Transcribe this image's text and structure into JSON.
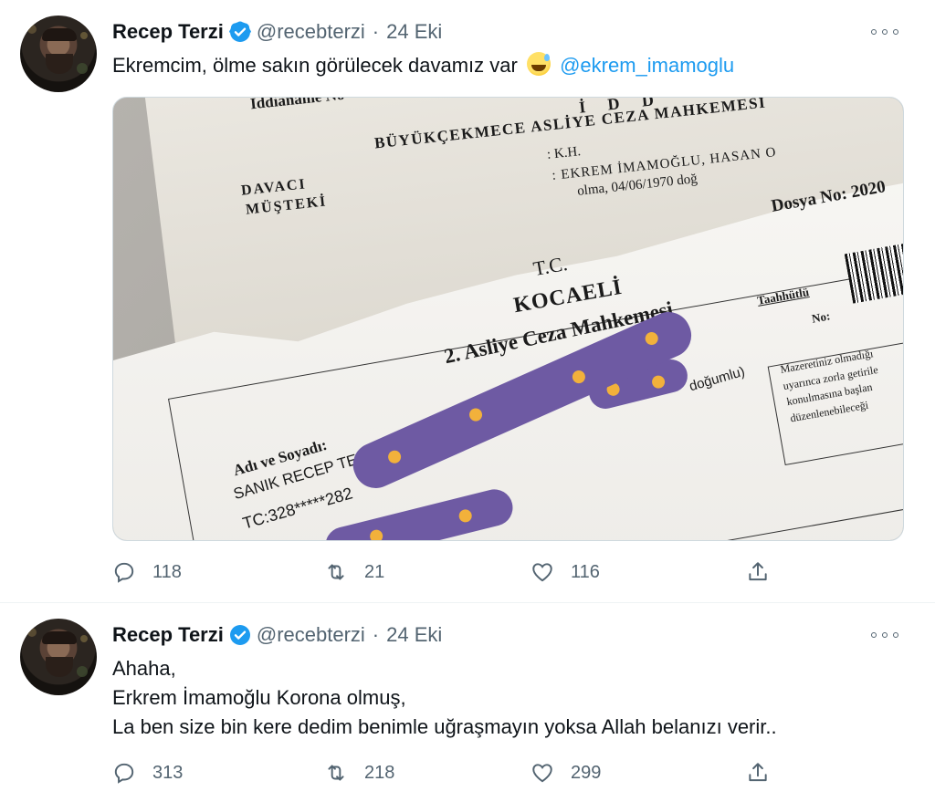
{
  "tweets": [
    {
      "name": "Recep Terzi",
      "handle": "@recebterzi",
      "separator": "·",
      "date": "24 Eki",
      "text_before": "Ekremcim, ölme sakın görülecek davamız var",
      "emoji": "grinning-sweat-emoji",
      "mention": "@ekrem_imamoglu",
      "media": {
        "lines": {
          "header_court": "BÜYÜKÇEKMECE ASLİYE CEZA MAHKEMESİ",
          "iddianame": "İddianame No",
          "idd": "İ D D",
          "davaci": "DAVACI",
          "musteki": "MÜŞTEKİ",
          "kh": ": K.H.",
          "ekrem": ": EKREM İMAMOĞLU, HASAN O",
          "olma": "olma, 04/06/1970 doğ",
          "dosya": "Dosya No: 2020",
          "tc": "T.C.",
          "kocaeli": "KOCAELİ",
          "asliye": "2. Asliye Ceza Mahkemesi",
          "taahhutlu": "Taahhütlü",
          "no": "No:",
          "adi": "Adı ve Soyadı:",
          "sanik": "SANIK RECEP TERZİ (RÜŞAN, ŞAZİVER oğlu 0",
          "dogumlu": "doğumlu)",
          "tcno": "TC:328*****282",
          "side1": "Mazeretiniz olmadığı",
          "side2": "uyarınca zorla getirile",
          "side3": "konulmasına başlan",
          "side4": "düzenlenebileceği"
        }
      },
      "stats": {
        "replies": "118",
        "retweets": "21",
        "likes": "116"
      }
    },
    {
      "name": "Recep Terzi",
      "handle": "@recebterzi",
      "separator": "·",
      "date": "24 Eki",
      "lines": [
        "Ahaha,",
        "Erkrem İmamoğlu Korona olmuş,",
        "La ben size bin kere dedim benimle uğraşmayın yoksa Allah belanızı verir.."
      ],
      "stats": {
        "replies": "313",
        "retweets": "218",
        "likes": "299"
      }
    }
  ],
  "colors": {
    "text": "#0f1419",
    "secondary": "#536471",
    "accent": "#1d9bf0",
    "verified": "#1d9bf0",
    "divider": "#eff3f4"
  }
}
